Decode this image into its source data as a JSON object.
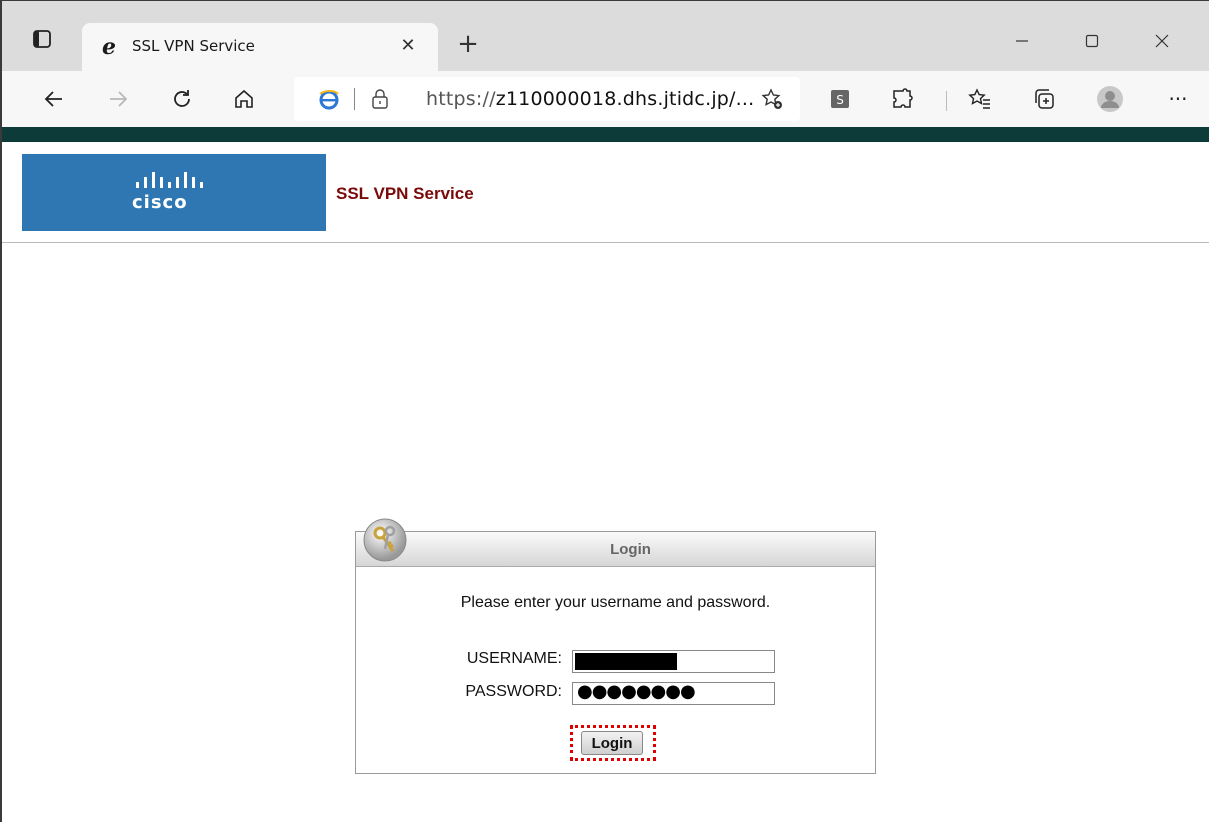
{
  "browser": {
    "tab": {
      "title": "SSL VPN Service",
      "close_glyph": "✕"
    },
    "new_tab_glyph": "+",
    "window_controls": {
      "minimize": "minimize-icon",
      "maximize": "maximize-icon",
      "close": "close-icon"
    },
    "address": {
      "url_prefix": "https://",
      "url_host": "z110000018.dhs.jtidc.jp/...",
      "icons": [
        "ie-icon",
        "lock-icon",
        "favorite-add-icon"
      ]
    },
    "toolbar_icons": [
      "back-icon",
      "forward-icon",
      "refresh-icon",
      "home-icon",
      "extension-s-icon",
      "extensions-icon",
      "favorites-icon",
      "collections-icon",
      "profile-icon",
      "more-icon"
    ],
    "more_glyph": "···",
    "extension_letter": "S"
  },
  "page": {
    "brand_word": "cisco",
    "service_title": "SSL VPN Service",
    "login": {
      "header_title": "Login",
      "prompt": "Please enter your username and password.",
      "username_label": "USERNAME:",
      "password_label": "PASSWORD:",
      "password_value": "●●●●●●●●",
      "submit_label": "Login"
    }
  }
}
